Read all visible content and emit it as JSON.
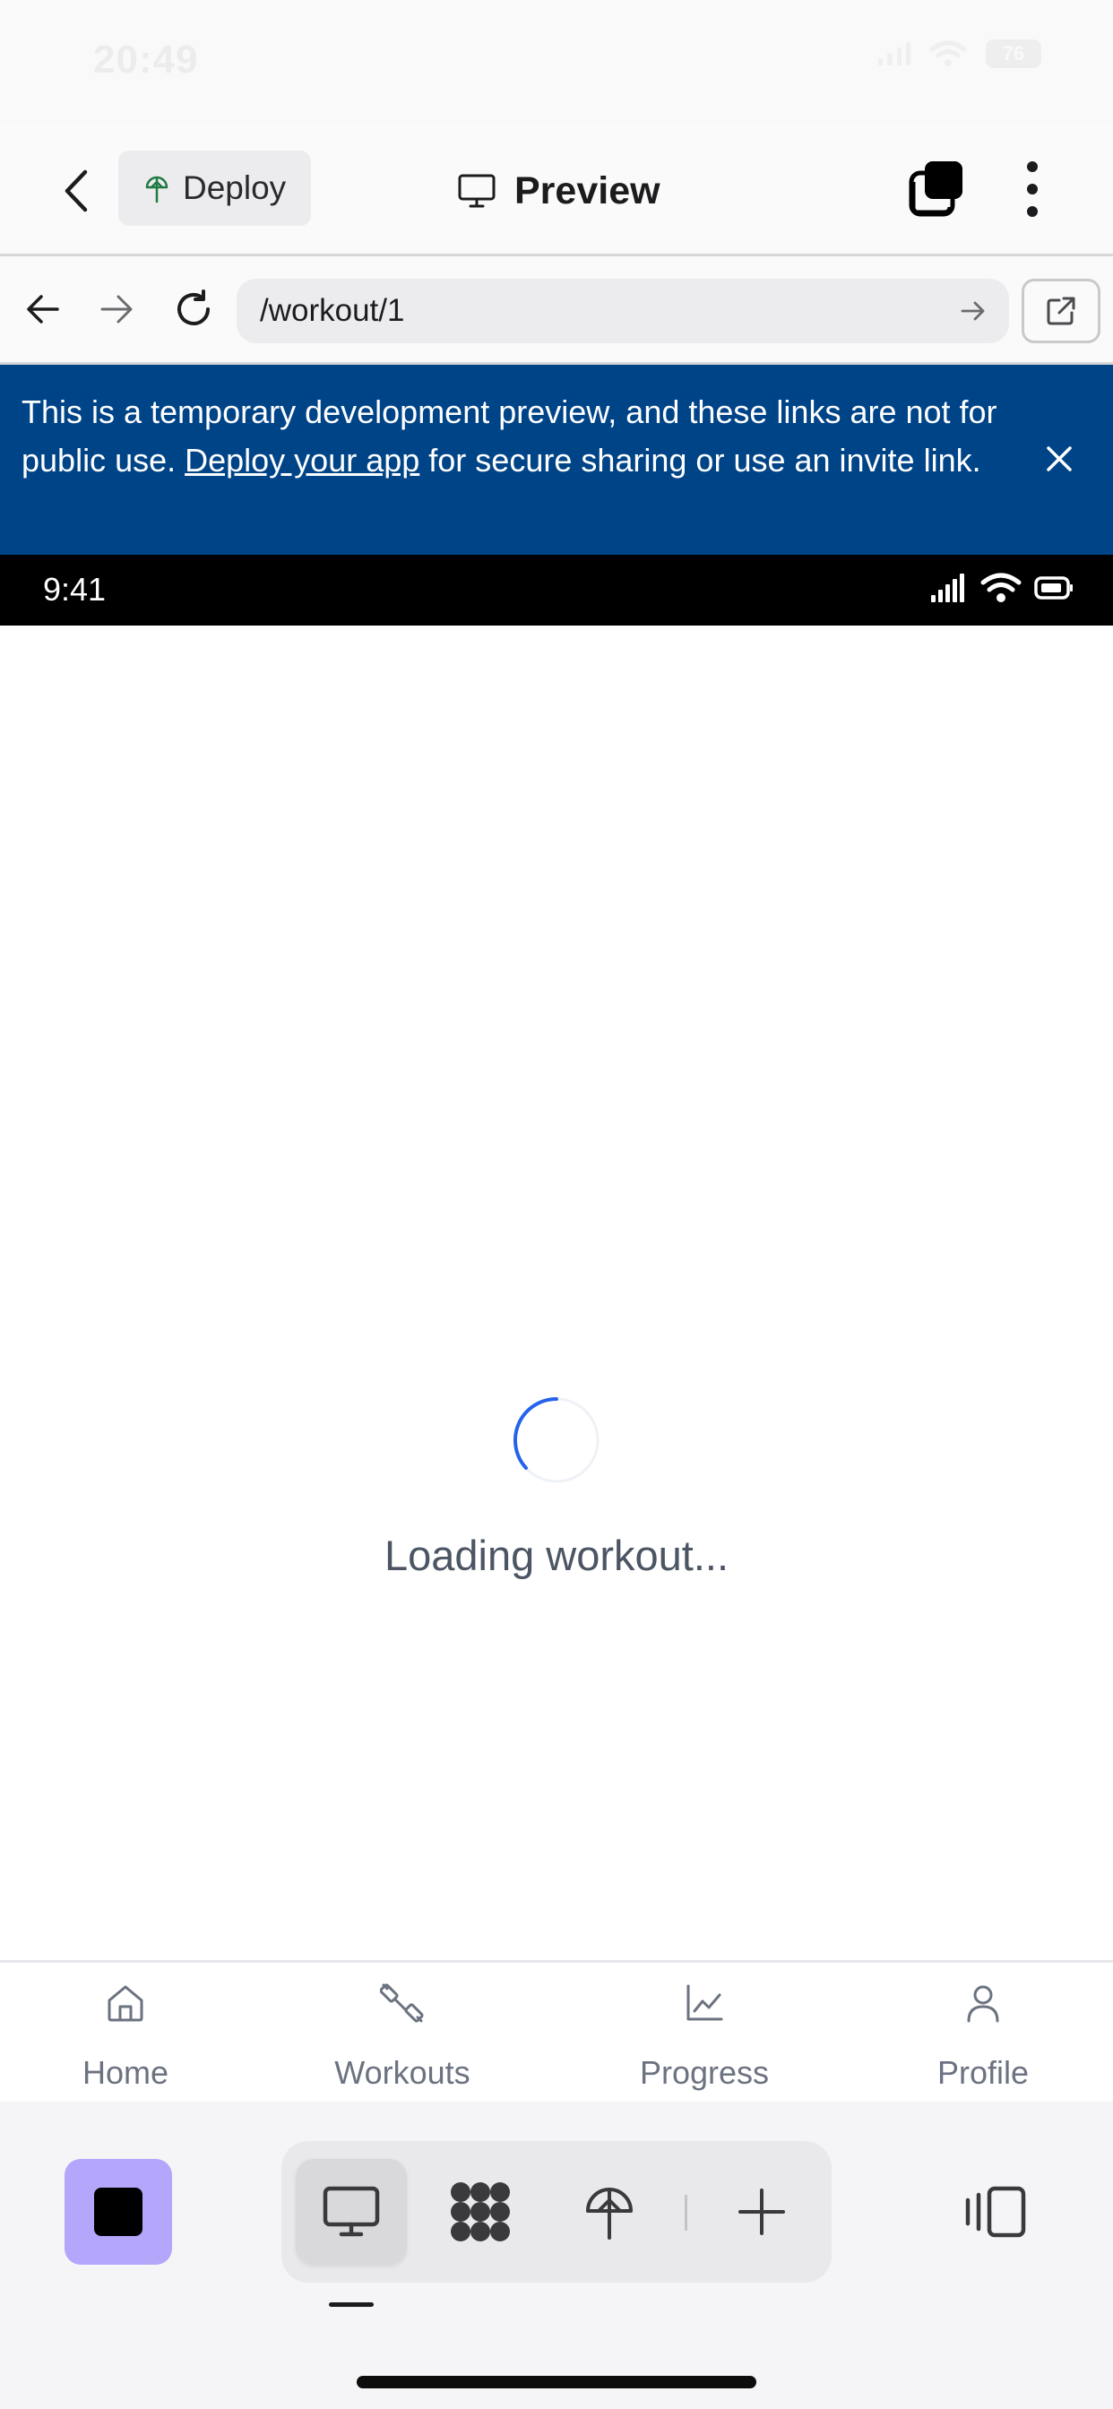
{
  "os_status": {
    "time": "20:49",
    "battery": "76"
  },
  "topbar": {
    "deploy_label": "Deploy",
    "title": "Preview"
  },
  "urlbar": {
    "url": "/workout/1"
  },
  "banner": {
    "text_before": "This is a temporary development preview, and these links are not for public use. ",
    "link": "Deploy your app",
    "text_after": " for secure sharing or use an invite link."
  },
  "app_status": {
    "time": "9:41"
  },
  "content": {
    "loading_text": "Loading workout..."
  },
  "tabbar": {
    "tabs": [
      {
        "label": "Home"
      },
      {
        "label": "Workouts"
      },
      {
        "label": "Progress"
      },
      {
        "label": "Profile"
      }
    ]
  },
  "colors": {
    "banner_bg": "#004488",
    "spinner": "#2563eb",
    "stop_button": "#b4a7fb"
  }
}
